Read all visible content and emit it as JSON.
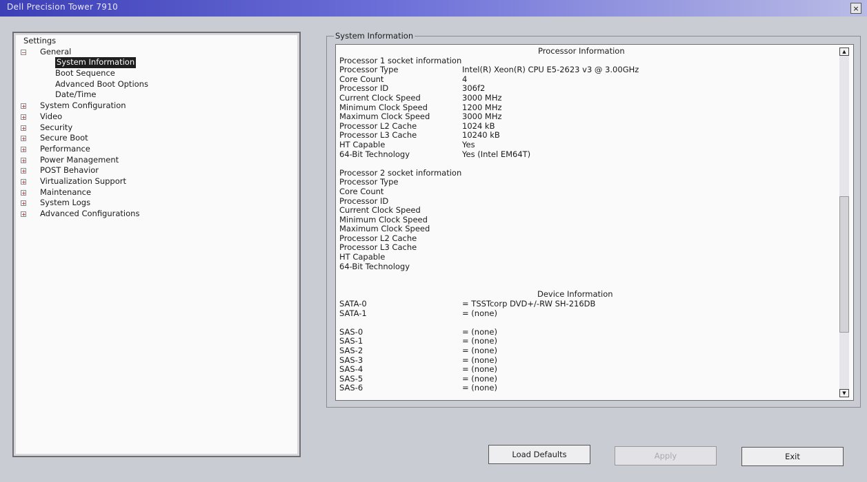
{
  "window": {
    "title": "Dell Precision Tower 7910",
    "close_glyph": "×"
  },
  "tree": [
    {
      "label": "Settings",
      "indent": 0,
      "toggle": ""
    },
    {
      "label": "General",
      "indent": 1,
      "toggle": "−"
    },
    {
      "label": "System Information",
      "indent": 2,
      "toggle": "",
      "selected": true
    },
    {
      "label": "Boot Sequence",
      "indent": 2,
      "toggle": ""
    },
    {
      "label": "Advanced Boot Options",
      "indent": 2,
      "toggle": ""
    },
    {
      "label": "Date/Time",
      "indent": 2,
      "toggle": ""
    },
    {
      "label": "System Configuration",
      "indent": 1,
      "toggle": "+"
    },
    {
      "label": "Video",
      "indent": 1,
      "toggle": "+"
    },
    {
      "label": "Security",
      "indent": 1,
      "toggle": "+"
    },
    {
      "label": "Secure Boot",
      "indent": 1,
      "toggle": "+"
    },
    {
      "label": "Performance",
      "indent": 1,
      "toggle": "+"
    },
    {
      "label": "Power Management",
      "indent": 1,
      "toggle": "+"
    },
    {
      "label": "POST Behavior",
      "indent": 1,
      "toggle": "+"
    },
    {
      "label": "Virtualization Support",
      "indent": 1,
      "toggle": "+"
    },
    {
      "label": "Maintenance",
      "indent": 1,
      "toggle": "+"
    },
    {
      "label": "System Logs",
      "indent": 1,
      "toggle": "+"
    },
    {
      "label": "Advanced Configurations",
      "indent": 1,
      "toggle": "+"
    }
  ],
  "info": {
    "caption": "System Information",
    "processor_heading": "Processor Information",
    "device_heading": "Device Information",
    "proc1_title": "Processor 1 socket information",
    "proc1": [
      {
        "k": "Processor Type",
        "v": "Intel(R) Xeon(R) CPU E5-2623 v3 @ 3.00GHz"
      },
      {
        "k": "Core Count",
        "v": "4"
      },
      {
        "k": "Processor ID",
        "v": "306f2"
      },
      {
        "k": "Current Clock Speed",
        "v": "3000 MHz"
      },
      {
        "k": "Minimum Clock Speed",
        "v": "1200 MHz"
      },
      {
        "k": "Maximum Clock Speed",
        "v": "3000 MHz"
      },
      {
        "k": "Processor L2 Cache",
        "v": "1024 kB"
      },
      {
        "k": "Processor L3 Cache",
        "v": "10240 kB"
      },
      {
        "k": "HT Capable",
        "v": "Yes"
      },
      {
        "k": "64-Bit Technology",
        "v": "Yes (Intel EM64T)"
      }
    ],
    "proc2_title": "Processor 2 socket information",
    "proc2": [
      {
        "k": "Processor Type",
        "v": ""
      },
      {
        "k": "Core Count",
        "v": ""
      },
      {
        "k": "Processor ID",
        "v": ""
      },
      {
        "k": "Current Clock Speed",
        "v": ""
      },
      {
        "k": "Minimum Clock Speed",
        "v": ""
      },
      {
        "k": "Maximum Clock Speed",
        "v": ""
      },
      {
        "k": "Processor L2 Cache",
        "v": ""
      },
      {
        "k": "Processor L3 Cache",
        "v": ""
      },
      {
        "k": "HT Capable",
        "v": ""
      },
      {
        "k": "64-Bit Technology",
        "v": ""
      }
    ],
    "sata": [
      {
        "k": "SATA-0",
        "v": "= TSSTcorp DVD+/-RW SH-216DB"
      },
      {
        "k": "SATA-1",
        "v": "= (none)"
      }
    ],
    "sas": [
      {
        "k": "SAS-0",
        "v": "= (none)"
      },
      {
        "k": "SAS-1",
        "v": "= (none)"
      },
      {
        "k": "SAS-2",
        "v": "= (none)"
      },
      {
        "k": "SAS-3",
        "v": "= (none)"
      },
      {
        "k": "SAS-4",
        "v": "= (none)"
      },
      {
        "k": "SAS-5",
        "v": "= (none)"
      },
      {
        "k": "SAS-6",
        "v": "= (none)"
      }
    ]
  },
  "scrollbar": {
    "up_glyph": "▲",
    "down_glyph": "▼"
  },
  "buttons": {
    "load_defaults": "Load Defaults",
    "apply": "Apply",
    "exit": "Exit"
  }
}
